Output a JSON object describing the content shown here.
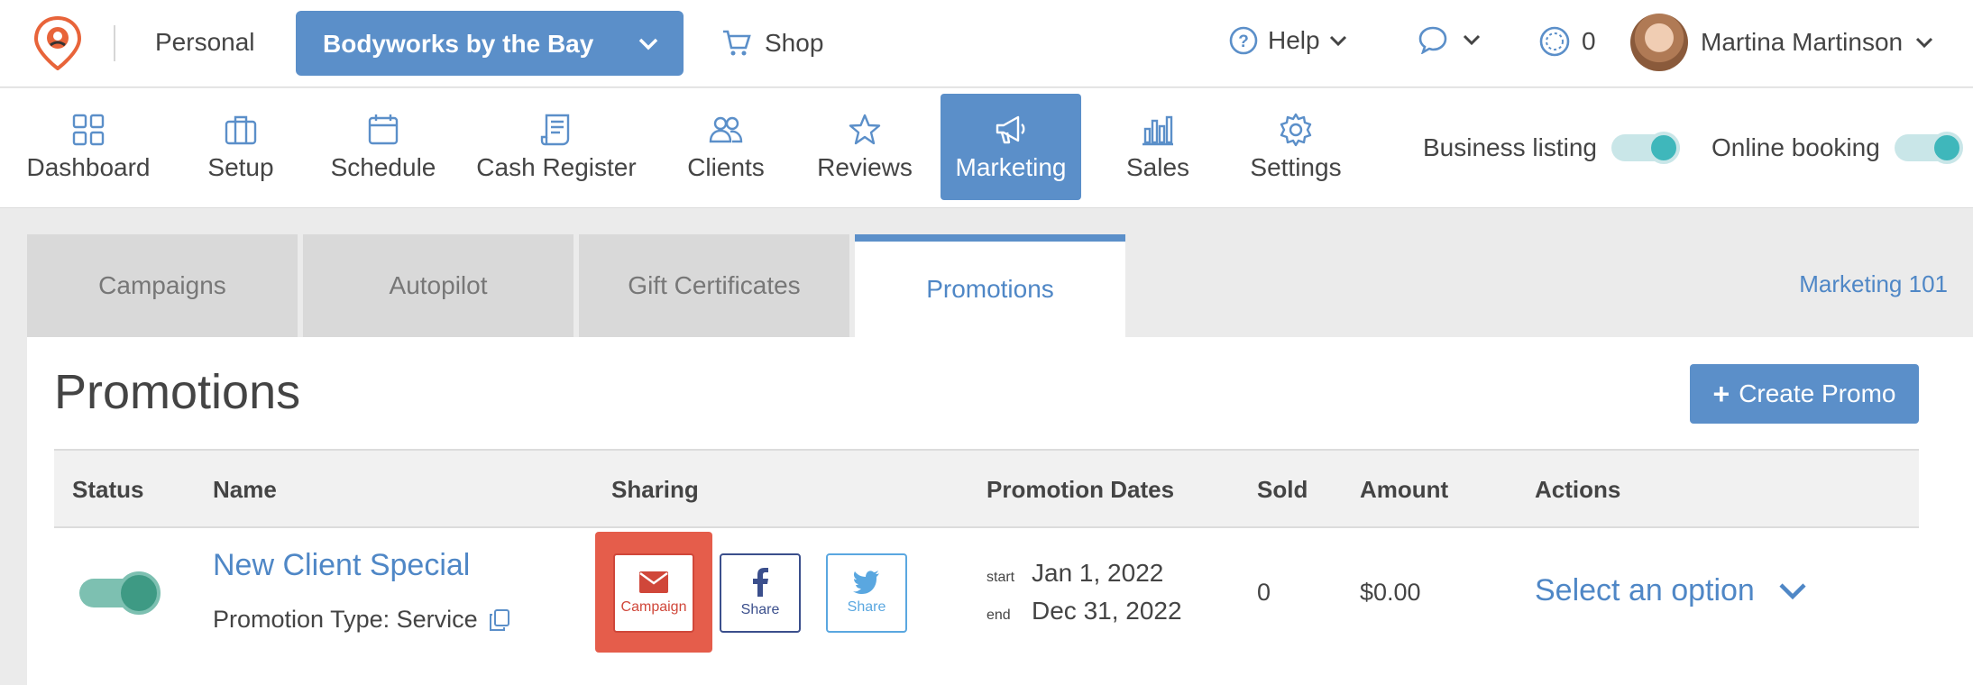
{
  "topbar": {
    "personal": "Personal",
    "business": "Bodyworks by the Bay",
    "shop": "Shop",
    "help": "Help",
    "credits": "0",
    "user_name": "Martina Martinson"
  },
  "nav": {
    "items": [
      {
        "label": "Dashboard",
        "icon": "grid-icon"
      },
      {
        "label": "Setup",
        "icon": "briefcase-icon"
      },
      {
        "label": "Schedule",
        "icon": "calendar-icon"
      },
      {
        "label": "Cash Register",
        "icon": "receipt-icon"
      },
      {
        "label": "Clients",
        "icon": "users-icon"
      },
      {
        "label": "Reviews",
        "icon": "star-icon"
      },
      {
        "label": "Marketing",
        "icon": "megaphone-icon"
      },
      {
        "label": "Sales",
        "icon": "bar-chart-icon"
      },
      {
        "label": "Settings",
        "icon": "gear-icon"
      }
    ],
    "active": "Marketing",
    "business_listing": "Business listing",
    "online_booking": "Online booking"
  },
  "tabs": [
    {
      "label": "Campaigns"
    },
    {
      "label": "Autopilot"
    },
    {
      "label": "Gift Certificates"
    },
    {
      "label": "Promotions"
    }
  ],
  "active_tab": "Promotions",
  "marketing_101": "Marketing 101",
  "page": {
    "title": "Promotions",
    "create_label": "Create Promo"
  },
  "table": {
    "headers": [
      "Status",
      "Name",
      "Sharing",
      "Promotion Dates",
      "Sold",
      "Amount",
      "Actions"
    ],
    "rows": [
      {
        "status_on": true,
        "name": "New Client Special",
        "type": "Promotion Type: Service",
        "sharing": {
          "campaign": "Campaign",
          "facebook": "Share",
          "twitter": "Share"
        },
        "start_label": "start",
        "start": "Jan 1, 2022",
        "end_label": "end",
        "end": "Dec 31, 2022",
        "sold": "0",
        "amount": "$0.00",
        "action": "Select an option"
      }
    ]
  },
  "colors": {
    "brand_blue": "#5b8fc9",
    "link_blue": "#4f87c6",
    "highlight_red": "#e55d4b",
    "toggle_teal": "#3fb7bb"
  }
}
